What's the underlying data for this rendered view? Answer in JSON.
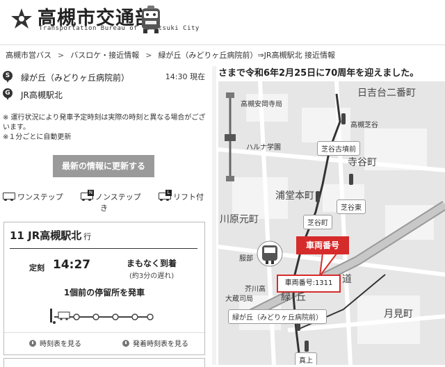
{
  "header": {
    "title": "高槻市交通部",
    "subtitle": "Transportation Bureau of Takatsuki City"
  },
  "breadcrumb": [
    "高槻市営バス",
    "バスロケ・接近情報",
    "緑が丘（みどりヶ丘病院前）⇒JR高槻駅北 接近情報"
  ],
  "stops": {
    "from_badge": "S",
    "from": "緑が丘（みどりヶ丘病院前）",
    "to_badge": "G",
    "to": "JR高槻駅北",
    "current_time": "14:30 現在"
  },
  "notes": [
    "※ 運行状況により発車予定時刻は実際の時刻と異なる場合がございます。",
    "※１分ごとに自動更新"
  ],
  "refresh_label": "最新の情報に更新する",
  "legend": [
    {
      "label": "ワンステップ",
      "tag": ""
    },
    {
      "label": "ノンステップ",
      "tag": "N",
      "wrap": "き"
    },
    {
      "label": "リフト付",
      "tag": "L"
    }
  ],
  "card": {
    "route_no": "11",
    "route_dest": "JR高槻駅北",
    "route_suffix": "行",
    "sched_label": "定刻",
    "sched_time": "14:27",
    "status": "まもなく到着",
    "delay": "(約3分の遅れ)",
    "prev_stop": "1個前の停留所を発車",
    "progress_stops": 5,
    "bus_position": 0,
    "timetable_link": "時刻表を見る",
    "departure_timetable_link": "発着時刻表を見る"
  },
  "map": {
    "ticker": "さまで令和6年2月25日に70周年を迎えました。",
    "vehicle_callout": "車両番号",
    "vehicle_number": "車両番号:1311",
    "labels": {
      "hiyoshi": "日吉台二番町",
      "shibatani_kofun": "芝谷古墳前",
      "teradani": "寺谷町",
      "uradohon": "浦堂本町",
      "shibatani_higashi": "芝谷東",
      "shibatani": "芝谷町",
      "kawahara": "川原元町",
      "midorigaoka": "緑が丘（みどりヶ丘病院前）",
      "tsukimi": "月見町",
      "shinkyoji": "高槻安岡寺局",
      "shibataniyochi": "高槻芝谷",
      "haruna": "ハルナ学園",
      "akutagawa": "芥川高",
      "ohkura": "大蔵司局",
      "midori_kanji": "緑",
      "oka_kanji": "丘",
      "road": "道",
      "uekami": "真上",
      "hattori": "服部"
    }
  },
  "colors": {
    "accent_red": "#d62b2b",
    "button_gray": "#9a9a9a"
  }
}
